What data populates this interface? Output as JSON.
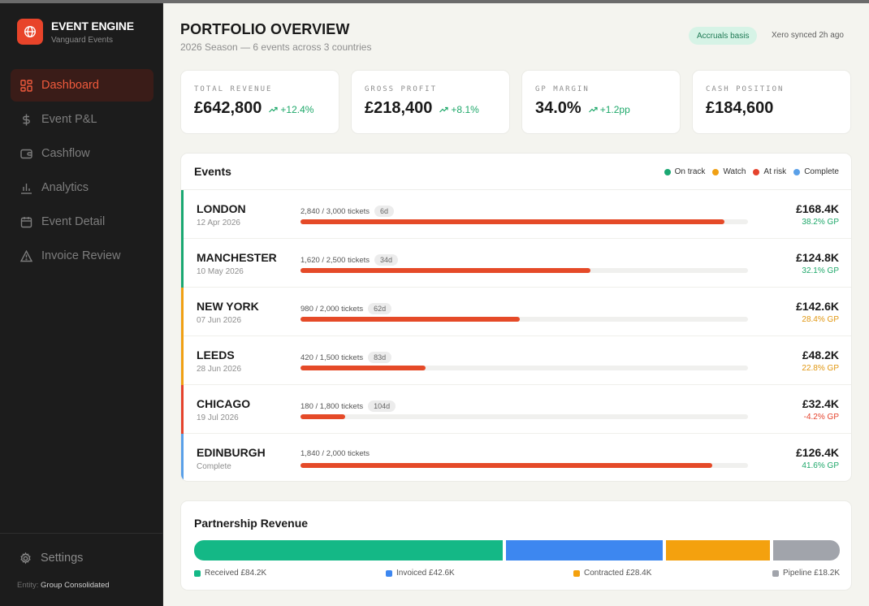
{
  "brand": {
    "title": "EVENT ENGINE",
    "subtitle": "Vanguard Events"
  },
  "nav": [
    {
      "label": "Dashboard",
      "icon": "dashboard-icon",
      "active": true
    },
    {
      "label": "Event P&L",
      "icon": "dollar-icon",
      "active": false
    },
    {
      "label": "Cashflow",
      "icon": "wallet-icon",
      "active": false
    },
    {
      "label": "Analytics",
      "icon": "bar-chart-icon",
      "active": false
    },
    {
      "label": "Event Detail",
      "icon": "calendar-icon",
      "active": false
    },
    {
      "label": "Invoice Review",
      "icon": "warning-icon",
      "active": false
    }
  ],
  "settings_label": "Settings",
  "entity": {
    "label": "Entity:",
    "value": "Group Consolidated"
  },
  "header": {
    "title": "PORTFOLIO OVERVIEW",
    "subtitle": "2026 Season — 6 events across 3 countries",
    "badge": "Accruals basis",
    "sync": "Xero synced 2h ago"
  },
  "kpis": [
    {
      "label": "TOTAL REVENUE",
      "value": "£642,800",
      "delta": "+12.4%"
    },
    {
      "label": "GROSS PROFIT",
      "value": "£218,400",
      "delta": "+8.1%"
    },
    {
      "label": "GP MARGIN",
      "value": "34.0%",
      "delta": "+1.2pp"
    },
    {
      "label": "CASH POSITION",
      "value": "£184,600",
      "delta": ""
    }
  ],
  "events_section": {
    "title": "Events",
    "legend": [
      {
        "label": "On track",
        "color": "#1aa872"
      },
      {
        "label": "Watch",
        "color": "#f0a014"
      },
      {
        "label": "At risk",
        "color": "#e5432d"
      },
      {
        "label": "Complete",
        "color": "#5aa0e8"
      }
    ],
    "rows": [
      {
        "name": "LONDON",
        "date": "12 Apr 2026",
        "tickets": "2,840 / 3,000 tickets",
        "days": "6d",
        "sold_fraction": 0.947,
        "value": "£168.4K",
        "gp": "38.2% GP",
        "status": "On track",
        "status_color": "#1aa872",
        "gp_color": "#1ea86a"
      },
      {
        "name": "MANCHESTER",
        "date": "10 May 2026",
        "tickets": "1,620 / 2,500 tickets",
        "days": "34d",
        "sold_fraction": 0.648,
        "value": "£124.8K",
        "gp": "32.1% GP",
        "status": "On track",
        "status_color": "#1aa872",
        "gp_color": "#1ea86a"
      },
      {
        "name": "NEW YORK",
        "date": "07 Jun 2026",
        "tickets": "980 / 2,000 tickets",
        "days": "62d",
        "sold_fraction": 0.49,
        "value": "£142.6K",
        "gp": "28.4% GP",
        "status": "Watch",
        "status_color": "#f0a014",
        "gp_color": "#e0960f"
      },
      {
        "name": "LEEDS",
        "date": "28 Jun 2026",
        "tickets": "420 / 1,500 tickets",
        "days": "83d",
        "sold_fraction": 0.28,
        "value": "£48.2K",
        "gp": "22.8% GP",
        "status": "Watch",
        "status_color": "#f0a014",
        "gp_color": "#e0960f"
      },
      {
        "name": "CHICAGO",
        "date": "19 Jul 2026",
        "tickets": "180 / 1,800 tickets",
        "days": "104d",
        "sold_fraction": 0.1,
        "value": "£32.4K",
        "gp": "-4.2% GP",
        "status": "At risk",
        "status_color": "#e5432d",
        "gp_color": "#e5432d"
      },
      {
        "name": "EDINBURGH",
        "date": "Complete",
        "tickets": "1,840 / 2,000 tickets",
        "days": "",
        "sold_fraction": 0.92,
        "value": "£126.4K",
        "gp": "41.6% GP",
        "status": "Complete",
        "status_color": "#5aa0e8",
        "gp_color": "#1ea86a"
      }
    ]
  },
  "partnership": {
    "title": "Partnership Revenue",
    "segments": [
      {
        "label": "Received £84.2K",
        "value": 84.2,
        "color": "#14b886"
      },
      {
        "label": "Invoiced £42.6K",
        "value": 42.6,
        "color": "#3d87f0"
      },
      {
        "label": "Contracted £28.4K",
        "value": 28.4,
        "color": "#f4a10e"
      },
      {
        "label": "Pipeline £18.2K",
        "value": 18.2,
        "color": "#a1a4ab"
      }
    ]
  }
}
